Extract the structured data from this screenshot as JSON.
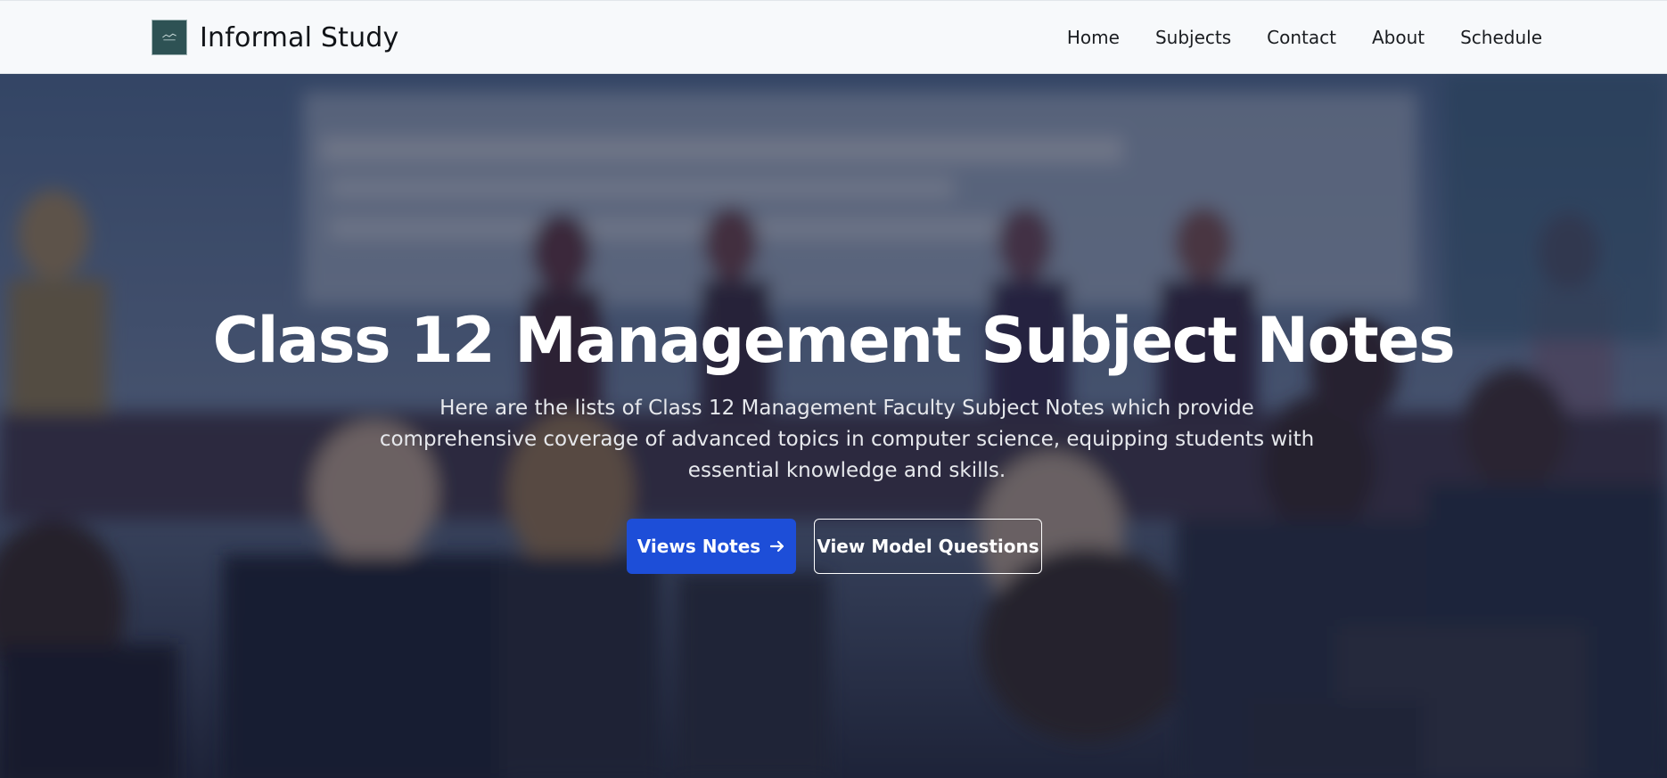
{
  "header": {
    "brand": "Informal Study",
    "nav": [
      "Home",
      "Subjects",
      "Contact",
      "About",
      "Schedule"
    ]
  },
  "hero": {
    "title": "Class 12 Management Subject Notes",
    "description": "Here are the lists of Class 12 Management Faculty Subject Notes which provide comprehensive coverage of advanced topics in computer science, equipping students with essential knowledge and skills.",
    "primary_button": "Views Notes",
    "secondary_button": "View Model Questions"
  },
  "colors": {
    "primary": "#1d4ed8",
    "header_bg": "#f7f9fb",
    "logo_bg": "#2e5254"
  },
  "icons": {
    "logo": "logo-icon",
    "button_arrow": "arrow-right-icon"
  }
}
